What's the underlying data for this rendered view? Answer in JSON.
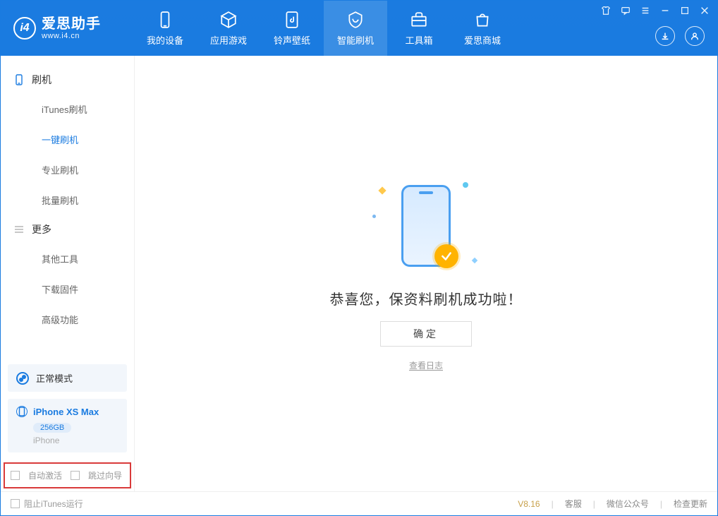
{
  "brand": {
    "title": "爱思助手",
    "url": "www.i4.cn",
    "logo_letter": "i4"
  },
  "tabs": [
    {
      "label": "我的设备",
      "icon": "device"
    },
    {
      "label": "应用游戏",
      "icon": "cube"
    },
    {
      "label": "铃声壁纸",
      "icon": "music-file"
    },
    {
      "label": "智能刷机",
      "icon": "shield-sync",
      "active": true
    },
    {
      "label": "工具箱",
      "icon": "toolbox"
    },
    {
      "label": "爱思商城",
      "icon": "bag"
    }
  ],
  "sidebar": {
    "group1": {
      "title": "刷机",
      "items": [
        "iTunes刷机",
        "一键刷机",
        "专业刷机",
        "批量刷机"
      ],
      "active_index": 1
    },
    "group2": {
      "title": "更多",
      "items": [
        "其他工具",
        "下载固件",
        "高级功能"
      ]
    },
    "mode_label": "正常模式",
    "device": {
      "name": "iPhone XS Max",
      "storage": "256GB",
      "type": "iPhone"
    },
    "opts": {
      "auto_activate": "自动激活",
      "skip_guide": "跳过向导"
    }
  },
  "main": {
    "message": "恭喜您，保资料刷机成功啦！",
    "ok": "确定",
    "log_link": "查看日志"
  },
  "footer": {
    "block_itunes": "阻止iTunes运行",
    "version": "V8.16",
    "support": "客服",
    "wechat": "微信公众号",
    "update": "检查更新"
  }
}
